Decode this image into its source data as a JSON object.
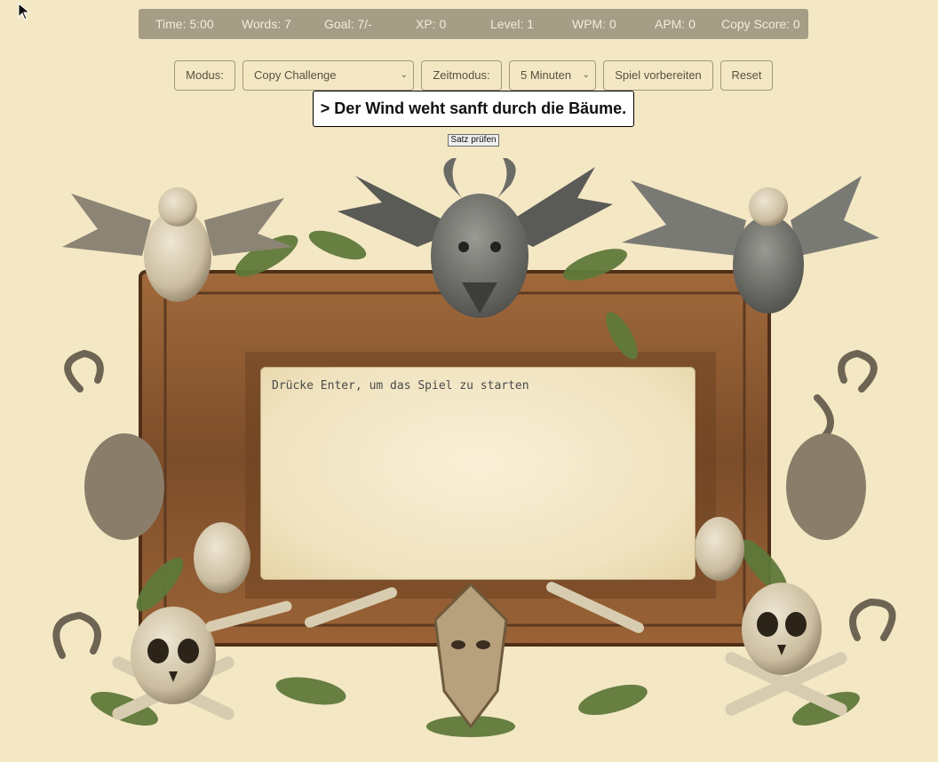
{
  "stats": {
    "time": "Time: 5:00",
    "words": "Words: 7",
    "goal": "Goal: 7/-",
    "xp": "XP: 0",
    "level": "Level: 1",
    "wpm": "WPM: 0",
    "apm": "APM: 0",
    "copy_score": "Copy Score: 0"
  },
  "controls": {
    "mode_label": "Modus:",
    "mode_value": "Copy Challenge",
    "time_mode_label": "Zeitmodus:",
    "time_mode_value": "5 Minuten",
    "prepare_button": "Spiel vorbereiten",
    "reset_button": "Reset"
  },
  "sentence": "> Der Wind weht sanft durch die Bäume.",
  "check_button": "Satz prüfen",
  "game_area": {
    "prompt": "Drücke Enter, um das Spiel zu starten"
  },
  "colors": {
    "background": "#f4e7c4",
    "stats_bar": "#a59d85",
    "wood": "#8a5a34"
  }
}
